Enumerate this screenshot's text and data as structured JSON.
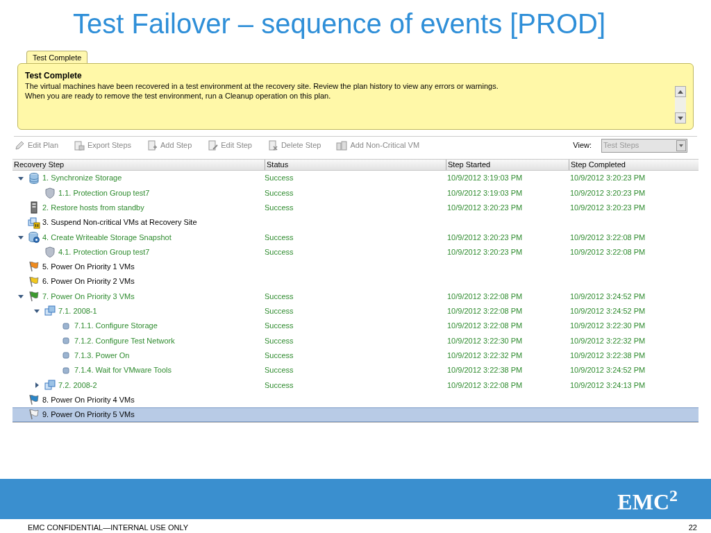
{
  "slide": {
    "title": "Test Failover – sequence of events [PROD]",
    "footer": "EMC CONFIDENTIAL—INTERNAL USE ONLY",
    "page_number": "22",
    "logo": "EMC$^{2}$"
  },
  "status_panel": {
    "tab": "Test Complete",
    "heading": "Test Complete",
    "lines": [
      "The virtual machines have been recovered in a test environment at the recovery site. Review the plan history to view any errors or warnings.",
      "When you are ready to remove the test environment, run a Cleanup operation on this plan."
    ]
  },
  "toolbar": {
    "items": [
      {
        "label": "Edit Plan",
        "kind": "edit",
        "disabled": true
      },
      {
        "label": "Export Steps",
        "kind": "export",
        "disabled": true
      },
      {
        "label": "Add Step",
        "kind": "add",
        "disabled": true
      },
      {
        "label": "Edit Step",
        "kind": "edit-step",
        "disabled": true
      },
      {
        "label": "Delete Step",
        "kind": "delete",
        "disabled": true
      },
      {
        "label": "Add Non-Critical VM",
        "kind": "vm",
        "disabled": true
      }
    ],
    "view_label": "View:",
    "view_value": "Test Steps",
    "view_disabled": true
  },
  "table": {
    "columns": [
      "Recovery Step",
      "Status",
      "Step Started",
      "Step Completed"
    ],
    "rows": [
      {
        "label": "1. Synchronize Storage",
        "kind": "storage",
        "succeeded": true,
        "status": "Success",
        "started": "10/9/2012 3:19:03 PM",
        "completed": "10/9/2012 3:20:23 PM",
        "expanded": true,
        "selected": false,
        "children": [
          {
            "label": "1.1. Protection Group test7",
            "kind": "shield",
            "succeeded": true,
            "status": "Success",
            "started": "10/9/2012 3:19:03 PM",
            "completed": "10/9/2012 3:20:23 PM",
            "selected": false
          }
        ]
      },
      {
        "label": "2. Restore hosts from standby",
        "kind": "host",
        "succeeded": true,
        "status": "Success",
        "started": "10/9/2012 3:20:23 PM",
        "completed": "10/9/2012 3:20:23 PM",
        "selected": false
      },
      {
        "label": "3. Suspend Non-critical VMs at Recovery Site",
        "kind": "vm-pause",
        "succeeded": false,
        "selected": false
      },
      {
        "label": "4. Create Writeable Storage Snapshot",
        "kind": "storage-gear",
        "succeeded": true,
        "status": "Success",
        "started": "10/9/2012 3:20:23 PM",
        "completed": "10/9/2012 3:22:08 PM",
        "expanded": true,
        "selected": false,
        "children": [
          {
            "label": "4.1. Protection Group test7",
            "kind": "shield",
            "succeeded": true,
            "status": "Success",
            "started": "10/9/2012 3:20:23 PM",
            "completed": "10/9/2012 3:22:08 PM",
            "selected": false
          }
        ]
      },
      {
        "label": "5. Power On Priority 1 VMs",
        "kind": "flag",
        "color": "#f08a1c",
        "succeeded": false,
        "selected": false
      },
      {
        "label": "6. Power On Priority 2 VMs",
        "kind": "flag",
        "color": "#f2c81e",
        "succeeded": false,
        "selected": false
      },
      {
        "label": "7. Power On Priority 3 VMs",
        "kind": "flag",
        "color": "#3c9a2e",
        "succeeded": true,
        "status": "Success",
        "started": "10/9/2012 3:22:08 PM",
        "completed": "10/9/2012 3:24:52 PM",
        "expanded": true,
        "selected": false,
        "children": [
          {
            "label": "7.1. 2008-1",
            "kind": "vm",
            "succeeded": true,
            "status": "Success",
            "started": "10/9/2012 3:22:08 PM",
            "completed": "10/9/2012 3:24:52 PM",
            "expanded": true,
            "selected": false,
            "children": [
              {
                "label": "7.1.1. Configure Storage",
                "kind": "task",
                "succeeded": true,
                "status": "Success",
                "started": "10/9/2012 3:22:08 PM",
                "completed": "10/9/2012 3:22:30 PM",
                "selected": false
              },
              {
                "label": "7.1.2. Configure Test Network",
                "kind": "task",
                "succeeded": true,
                "status": "Success",
                "started": "10/9/2012 3:22:30 PM",
                "completed": "10/9/2012 3:22:32 PM",
                "selected": false
              },
              {
                "label": "7.1.3. Power On",
                "kind": "task",
                "succeeded": true,
                "status": "Success",
                "started": "10/9/2012 3:22:32 PM",
                "completed": "10/9/2012 3:22:38 PM",
                "selected": false
              },
              {
                "label": "7.1.4. Wait for VMware Tools",
                "kind": "task",
                "succeeded": true,
                "status": "Success",
                "started": "10/9/2012 3:22:38 PM",
                "completed": "10/9/2012 3:24:52 PM",
                "selected": false
              }
            ]
          },
          {
            "label": "7.2. 2008-2",
            "kind": "vm",
            "succeeded": true,
            "status": "Success",
            "started": "10/9/2012 3:22:08 PM",
            "completed": "10/9/2012 3:24:13 PM",
            "expanded": false,
            "selected": false
          }
        ]
      },
      {
        "label": "8. Power On Priority 4 VMs",
        "kind": "flag",
        "color": "#2a86c8",
        "succeeded": false,
        "selected": false
      },
      {
        "label": "9. Power On Priority 5 VMs",
        "kind": "flag",
        "color": "#f4f4f4",
        "succeeded": false,
        "selected": true
      }
    ]
  }
}
